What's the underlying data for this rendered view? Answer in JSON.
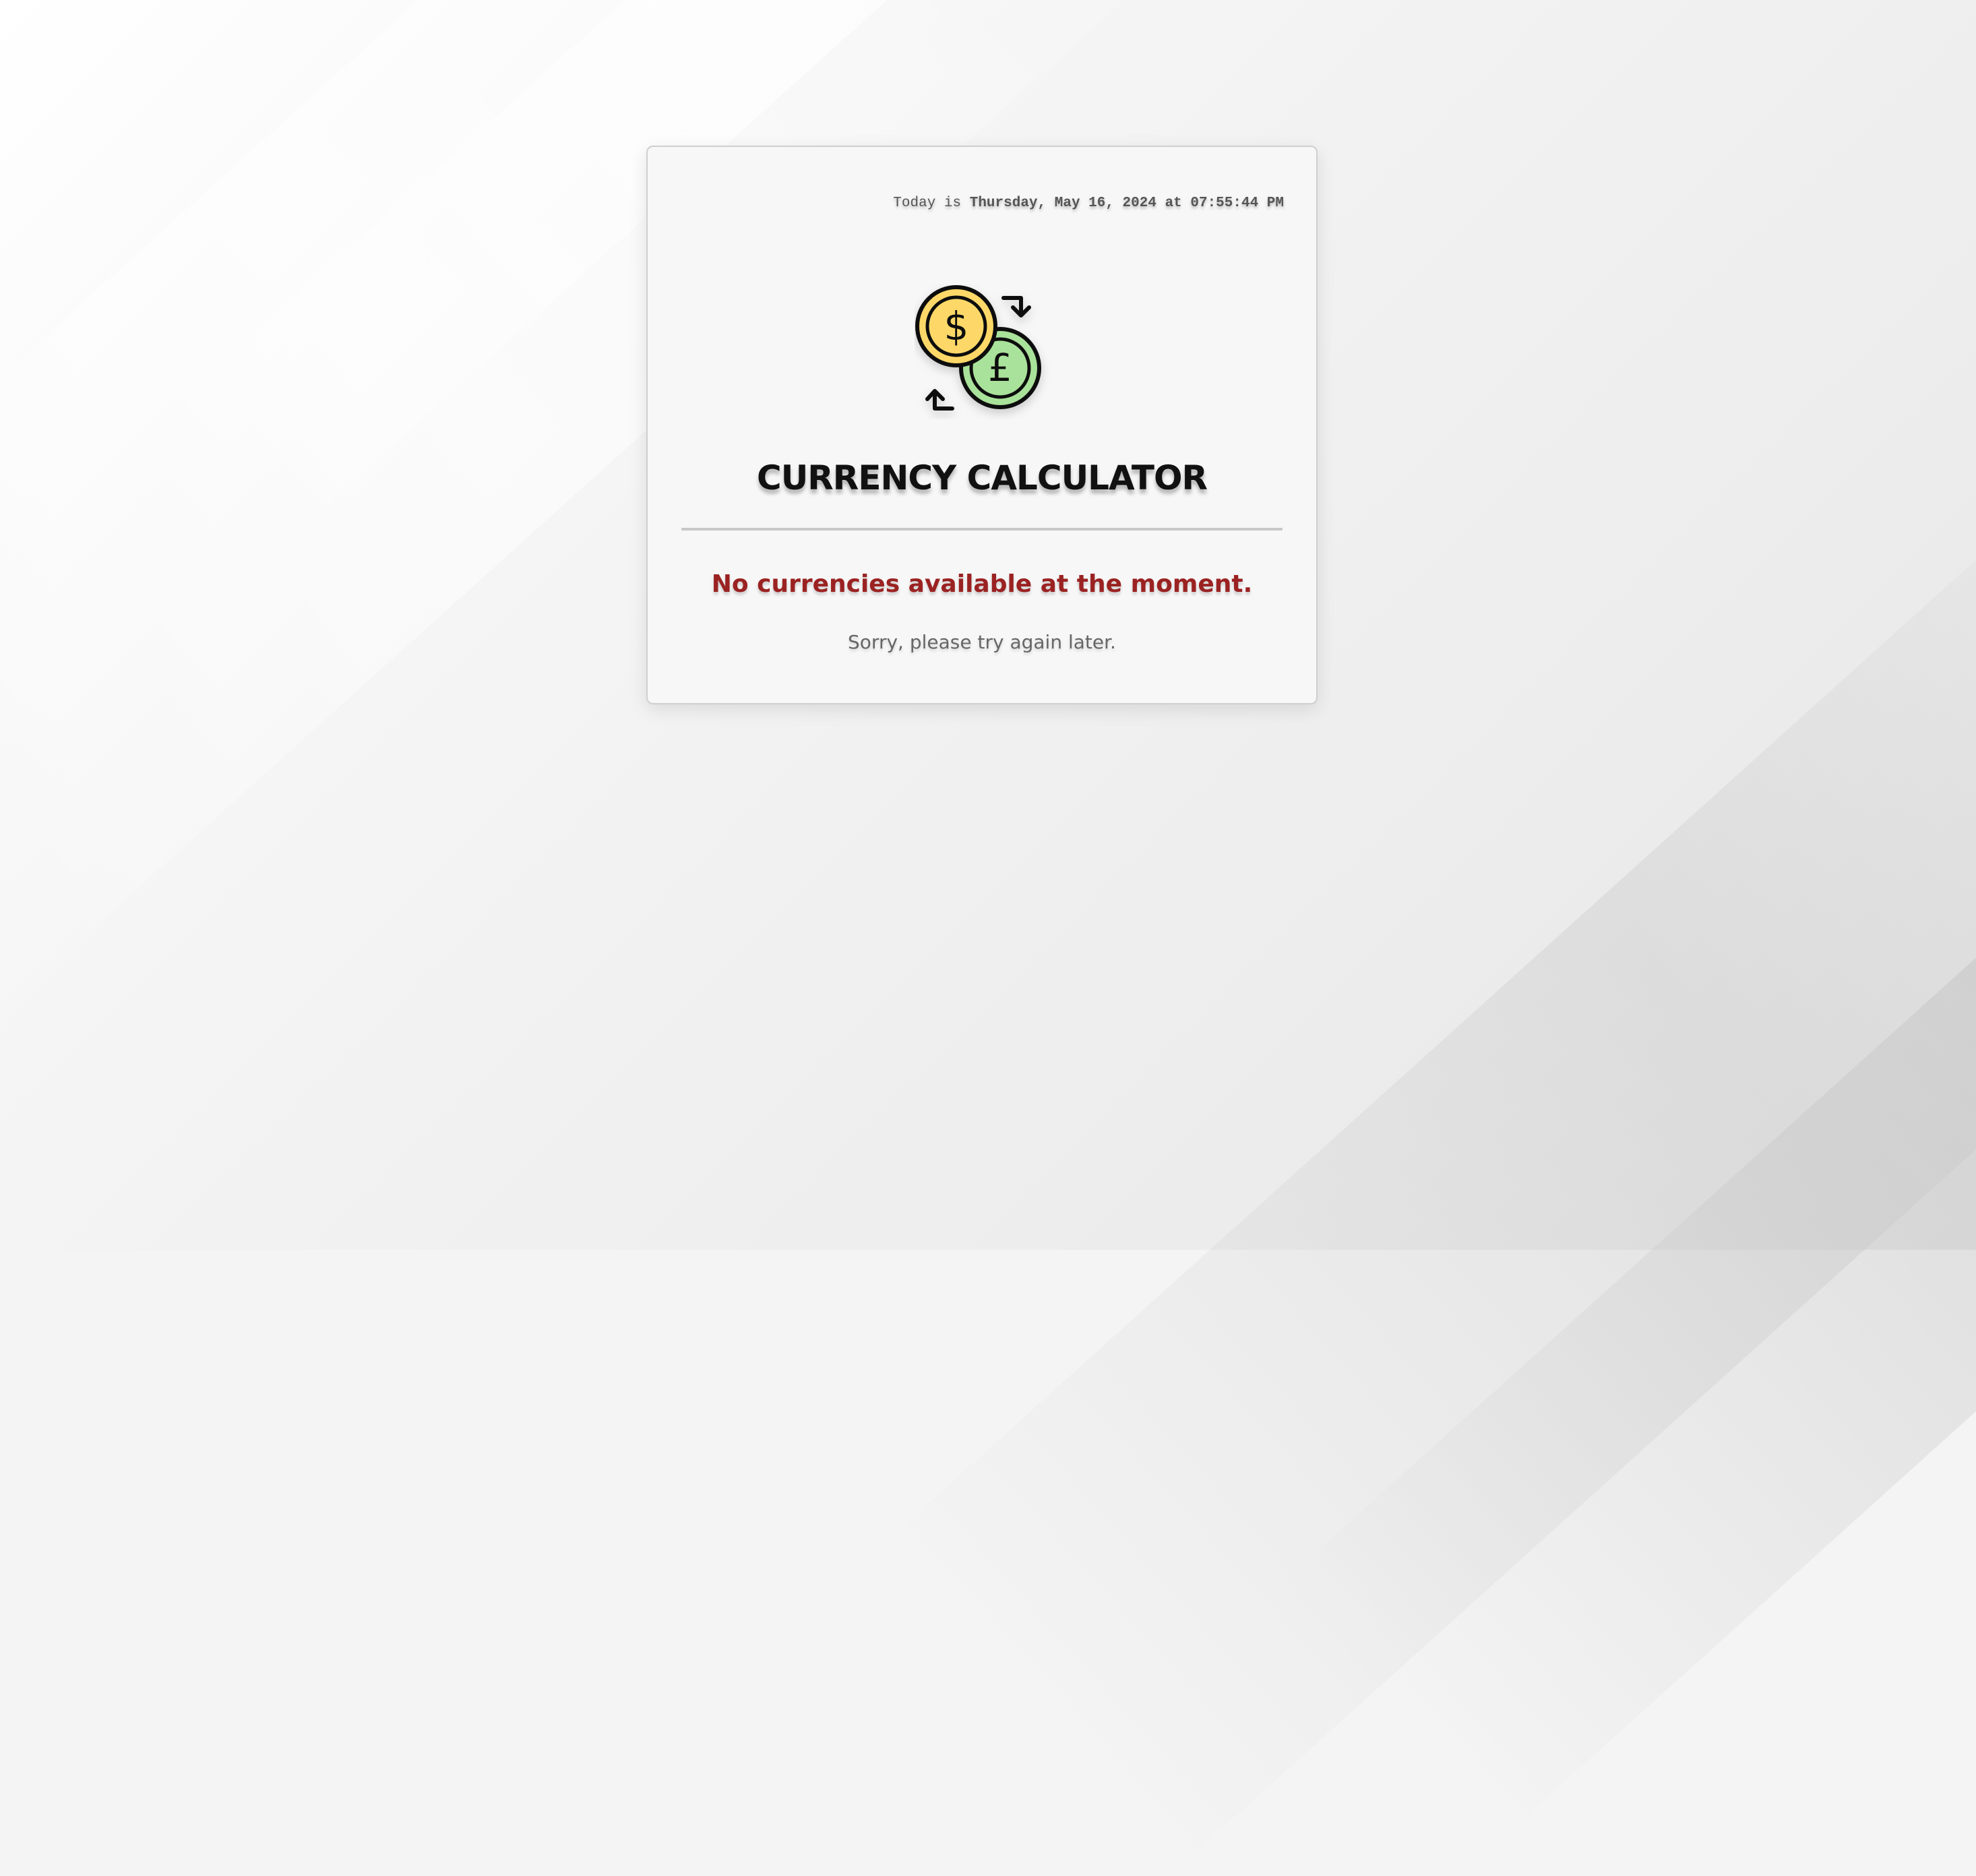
{
  "header": {
    "date_prefix": "Today is",
    "date_value": "Thursday, May 16, 2024 at 07:55:44 PM"
  },
  "logo": {
    "icon": "currency-exchange-icon",
    "coin_top_symbol": "$",
    "coin_bottom_symbol": "£",
    "colors": {
      "coin_top": "#fdd868",
      "coin_bottom": "#a9e29a",
      "outline": "#111111"
    }
  },
  "main": {
    "title": "CURRENCY CALCULATOR",
    "error_message": "No currencies available at the moment.",
    "error_hint": "Sorry, please try again later."
  },
  "colors": {
    "error_text": "#9b2222",
    "hint_text": "#666666",
    "card_background": "#f7f7f7"
  }
}
